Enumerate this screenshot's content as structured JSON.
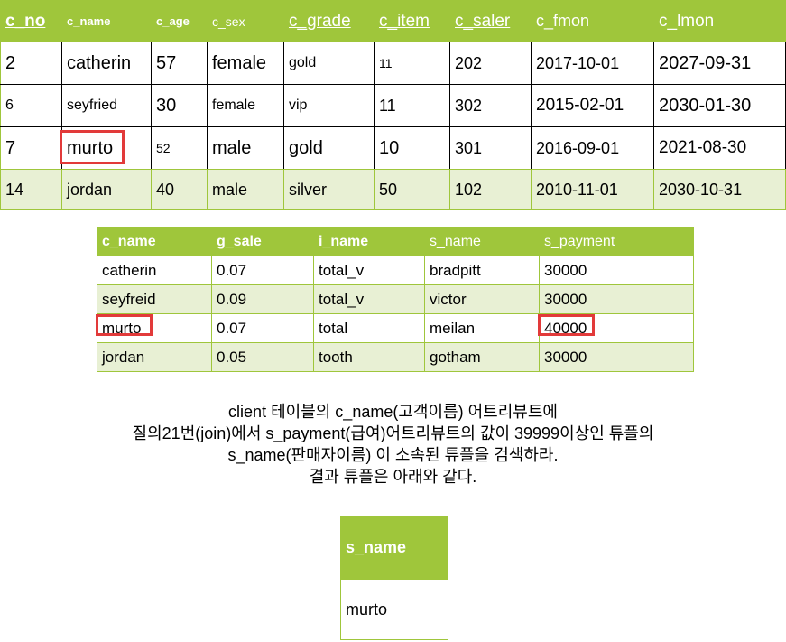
{
  "table1": {
    "headers": [
      "c_no",
      "c_name",
      "c_age",
      "c_sex",
      "c_grade",
      "c_item",
      "c_saler",
      "c_fmon",
      "c_lmon"
    ],
    "rows": [
      [
        "2",
        "catherin",
        "57",
        "female",
        "gold",
        "11",
        "202",
        "2017-10-01",
        "2027-09-31"
      ],
      [
        "6",
        "seyfried",
        "30",
        "female",
        "vip",
        "11",
        "302",
        "2015-02-01",
        "2030-01-30"
      ],
      [
        "7",
        "murto",
        "52",
        "male",
        "gold",
        "10",
        "301",
        "2016-09-01",
        "2021-08-30"
      ],
      [
        "14",
        "jordan",
        "40",
        "male",
        "silver",
        "50",
        "102",
        "2010-11-01",
        "2030-10-31"
      ]
    ]
  },
  "table2": {
    "headers": [
      "c_name",
      "g_sale",
      "i_name",
      "s_name",
      "s_payment"
    ],
    "rows": [
      [
        "catherin",
        "0.07",
        "total_v",
        "bradpitt",
        "30000"
      ],
      [
        "seyfreid",
        "0.09",
        "total_v",
        "victor",
        "30000"
      ],
      [
        "murto",
        "0.07",
        "total",
        "meilan",
        "40000"
      ],
      [
        "jordan",
        "0.05",
        "tooth",
        "gotham",
        "30000"
      ]
    ]
  },
  "description": {
    "line1": "client 테이블의 c_name(고객이름) 어트리뷰트에",
    "line2": "질의21번(join)에서 s_payment(급여)어트리뷰트의 값이 39999이상인 튜플의",
    "line3": "s_name(판매자이름) 이 소속된 튜플을 검색하라.",
    "line4": "결과 튜플은 아래와 같다."
  },
  "result": {
    "header": "s_name",
    "value": "murto"
  },
  "colors": {
    "header_green": "#9fc63b",
    "alt_row": "#e8f0d4",
    "highlight_red": "#e23a3a"
  }
}
